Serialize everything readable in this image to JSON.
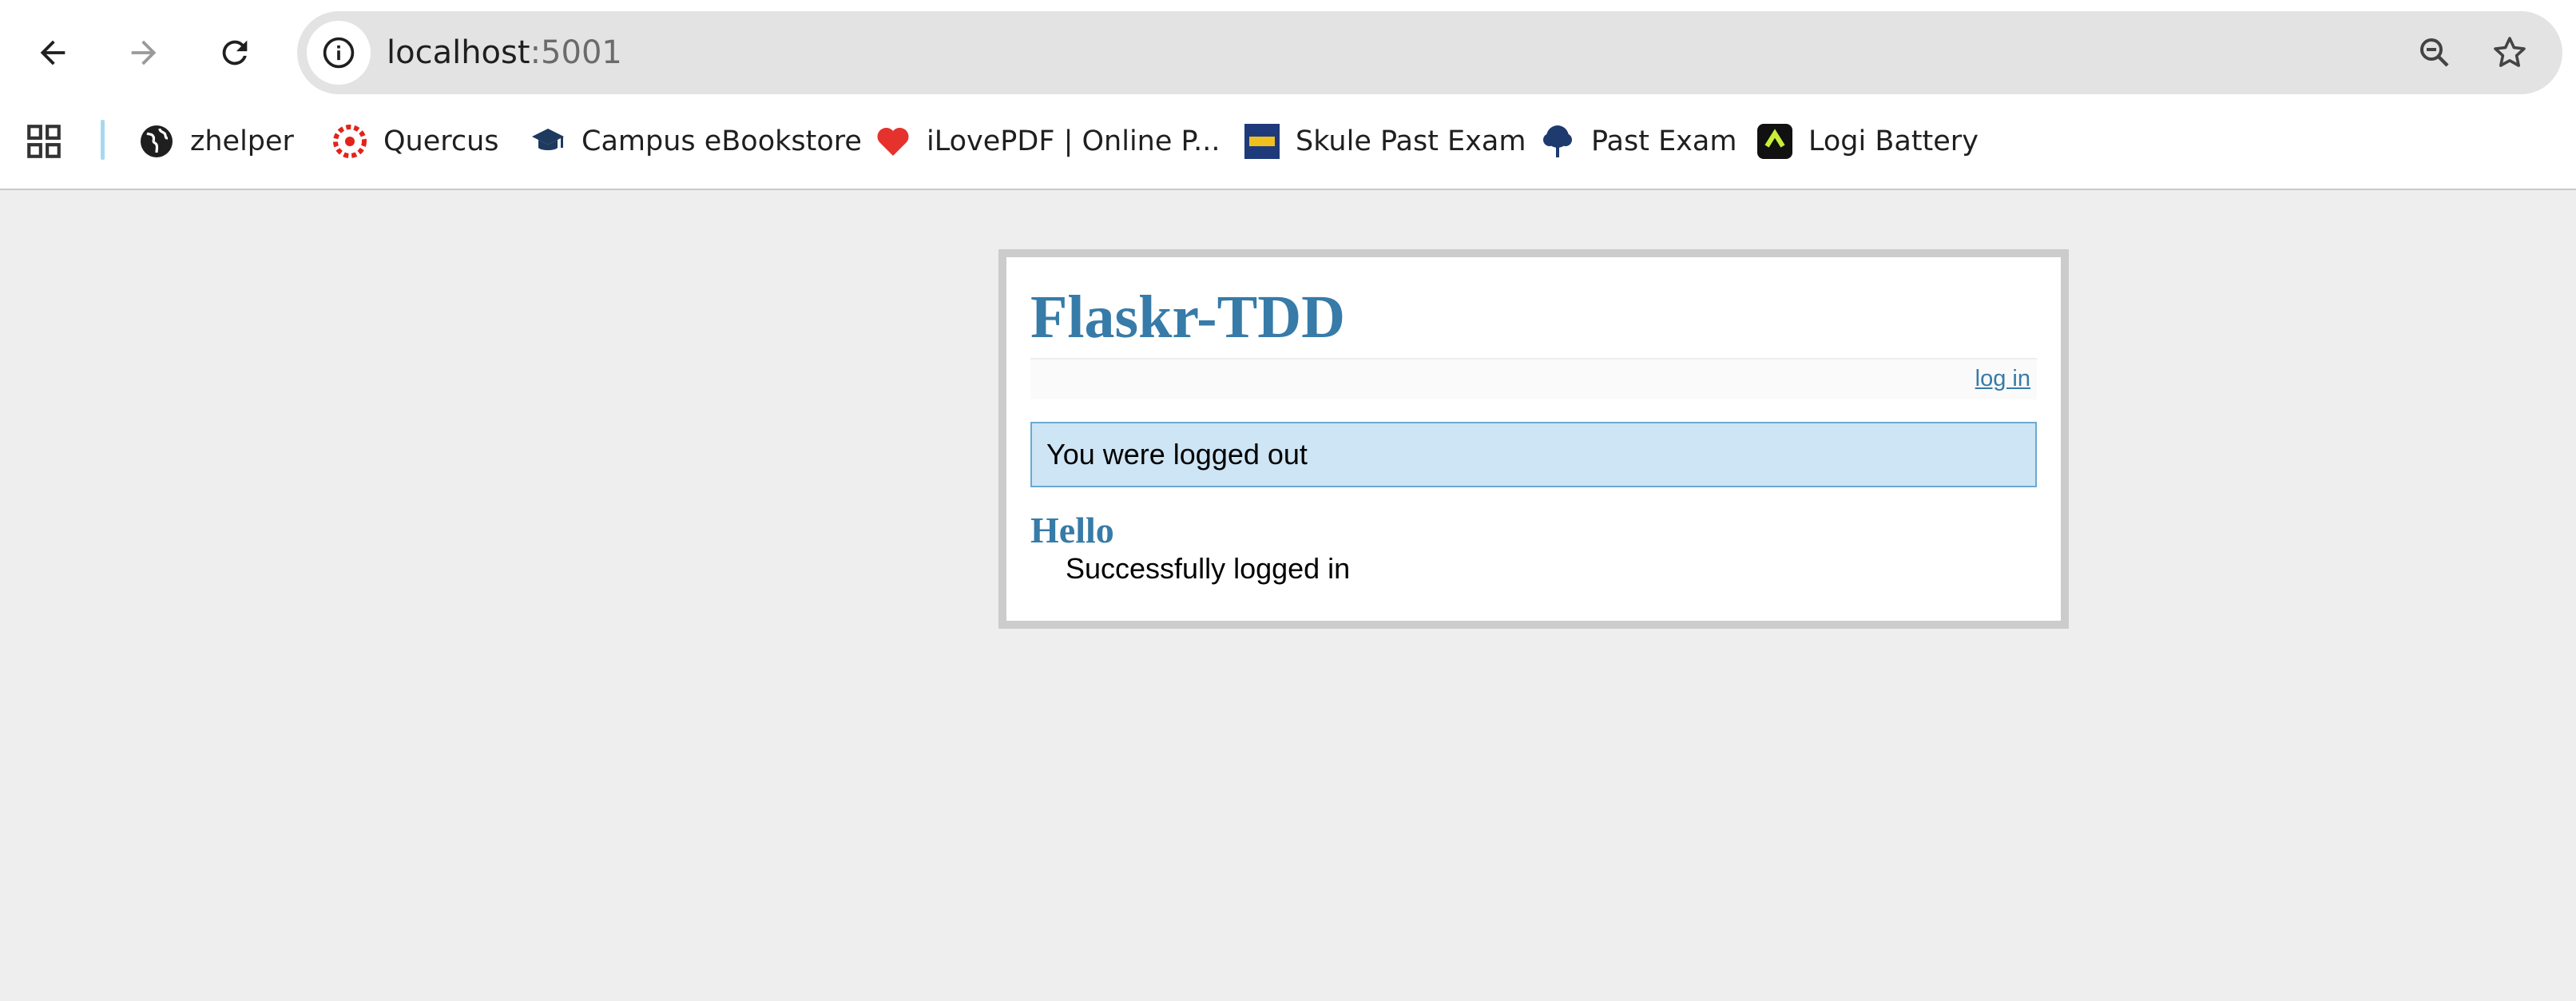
{
  "browser": {
    "url_host": "localhost",
    "url_port": ":5001",
    "bookmarks": [
      {
        "label": "zhelper",
        "icon": "globe-icon"
      },
      {
        "label": "Quercus",
        "icon": "quercus-icon"
      },
      {
        "label": "Campus eBookstore",
        "icon": "mortarboard-icon"
      },
      {
        "label": "iLovePDF | Online P...",
        "icon": "ilovepdf-heart-icon"
      },
      {
        "label": "Skule Past Exam",
        "icon": "skule-icon"
      },
      {
        "label": "Past Exam",
        "icon": "tree-icon"
      },
      {
        "label": "Logi Battery",
        "icon": "logi-icon"
      }
    ]
  },
  "app": {
    "title": "Flaskr-TDD",
    "login_link": "log in",
    "flash_message": "You were logged out",
    "entries": [
      {
        "title": "Hello",
        "text": "Successfully logged in"
      }
    ]
  },
  "colors": {
    "accent": "#377ba8",
    "flash_bg": "#cee5f5",
    "page_bg": "#eeeeee"
  }
}
